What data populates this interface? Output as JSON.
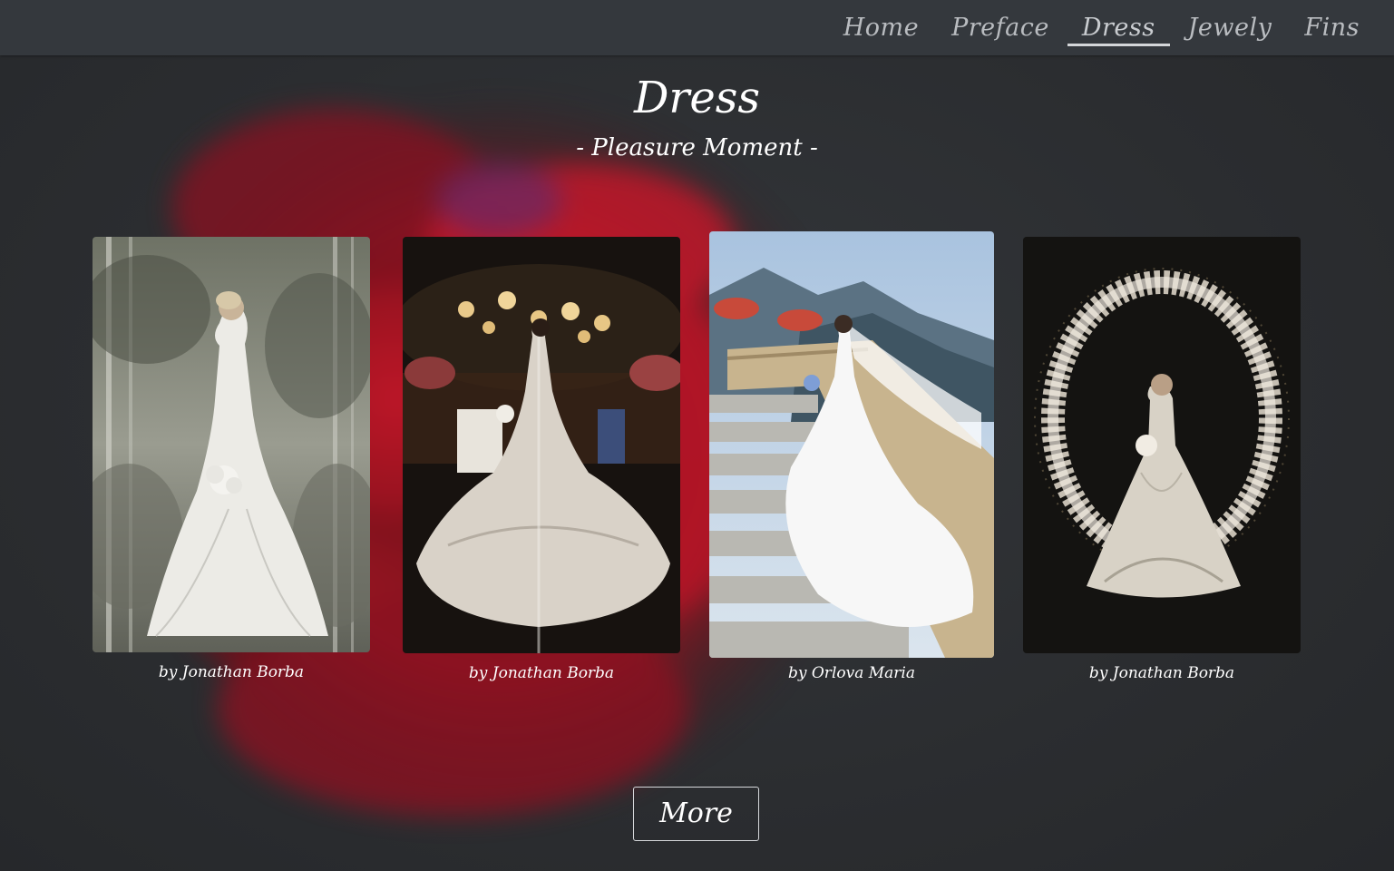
{
  "nav": {
    "items": [
      {
        "label": "Home",
        "active": false
      },
      {
        "label": "Preface",
        "active": false
      },
      {
        "label": "Dress",
        "active": true
      },
      {
        "label": "Jewely",
        "active": false
      },
      {
        "label": "Fins",
        "active": false
      }
    ]
  },
  "section": {
    "title": "Dress",
    "subtitle": "- Pleasure Moment -"
  },
  "gallery": [
    {
      "caption": "by Jonathan Borba",
      "scene": "bride-in-forest"
    },
    {
      "caption": "by Jonathan Borba",
      "scene": "bride-with-long-train"
    },
    {
      "caption": "by Orlova Maria",
      "scene": "bride-on-stairs"
    },
    {
      "caption": "by Jonathan Borba",
      "scene": "bride-flower-arch"
    }
  ],
  "more_button": {
    "label": "More"
  },
  "colors": {
    "nav_bg": "#34383d",
    "page_bg": "#2b2d30",
    "rose": "#b3121f",
    "text": "#ffffff"
  }
}
